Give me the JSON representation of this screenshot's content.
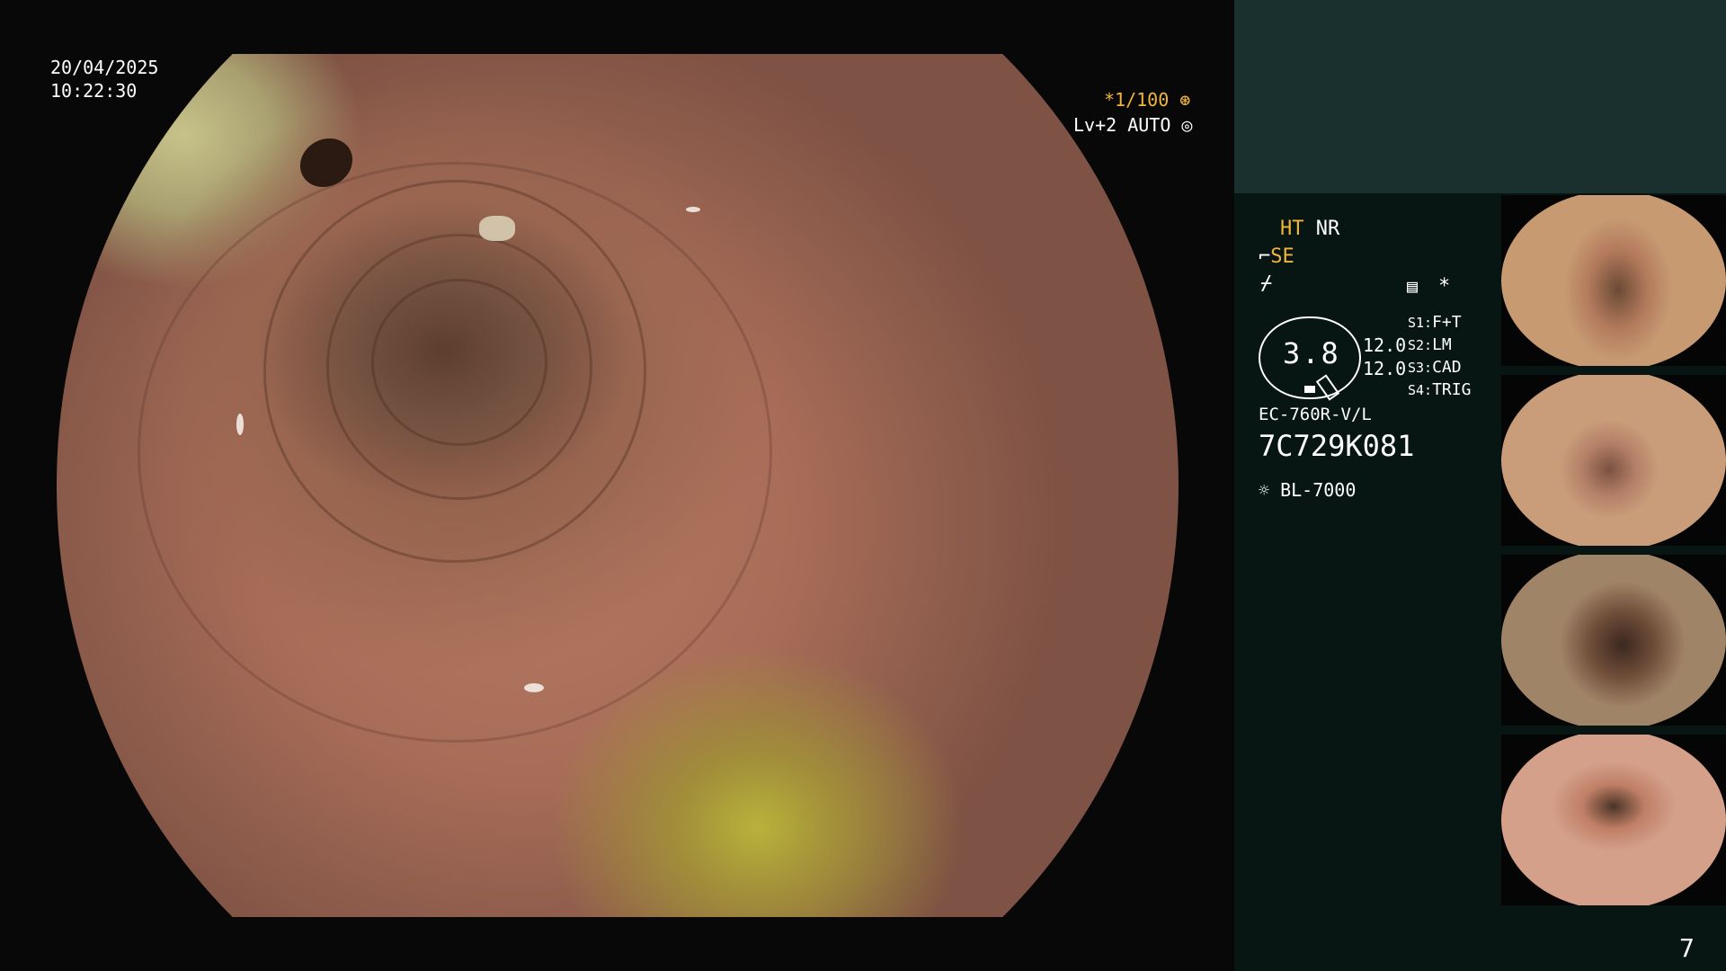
{
  "overlay": {
    "date": "20/04/2025",
    "time": "10:22:30",
    "shutter": "*1/100",
    "shutter_icon": "shutter-icon",
    "exposure": "Lv+2 AUTO",
    "exposure_icon": "auto-iris-icon"
  },
  "panel": {
    "ht": "HT",
    "nr": "NR",
    "se": "SE",
    "star": "*",
    "gauge_value": "3.8",
    "side_values": [
      "12.0",
      "12.0"
    ],
    "switches": [
      {
        "key": "S1:",
        "value": "F+T"
      },
      {
        "key": "S2:",
        "value": "LM"
      },
      {
        "key": "S3:",
        "value": "CAD"
      },
      {
        "key": "S4:",
        "value": "TRIG"
      }
    ],
    "scope_model": "EC-760R-V/L",
    "scope_serial": "7C729K081",
    "light_source": "BL-7000",
    "page_number": "7"
  },
  "colors": {
    "amber_accent": "#f1b53c",
    "panel_bg": "#071513",
    "panel_top": "#1a302e"
  }
}
